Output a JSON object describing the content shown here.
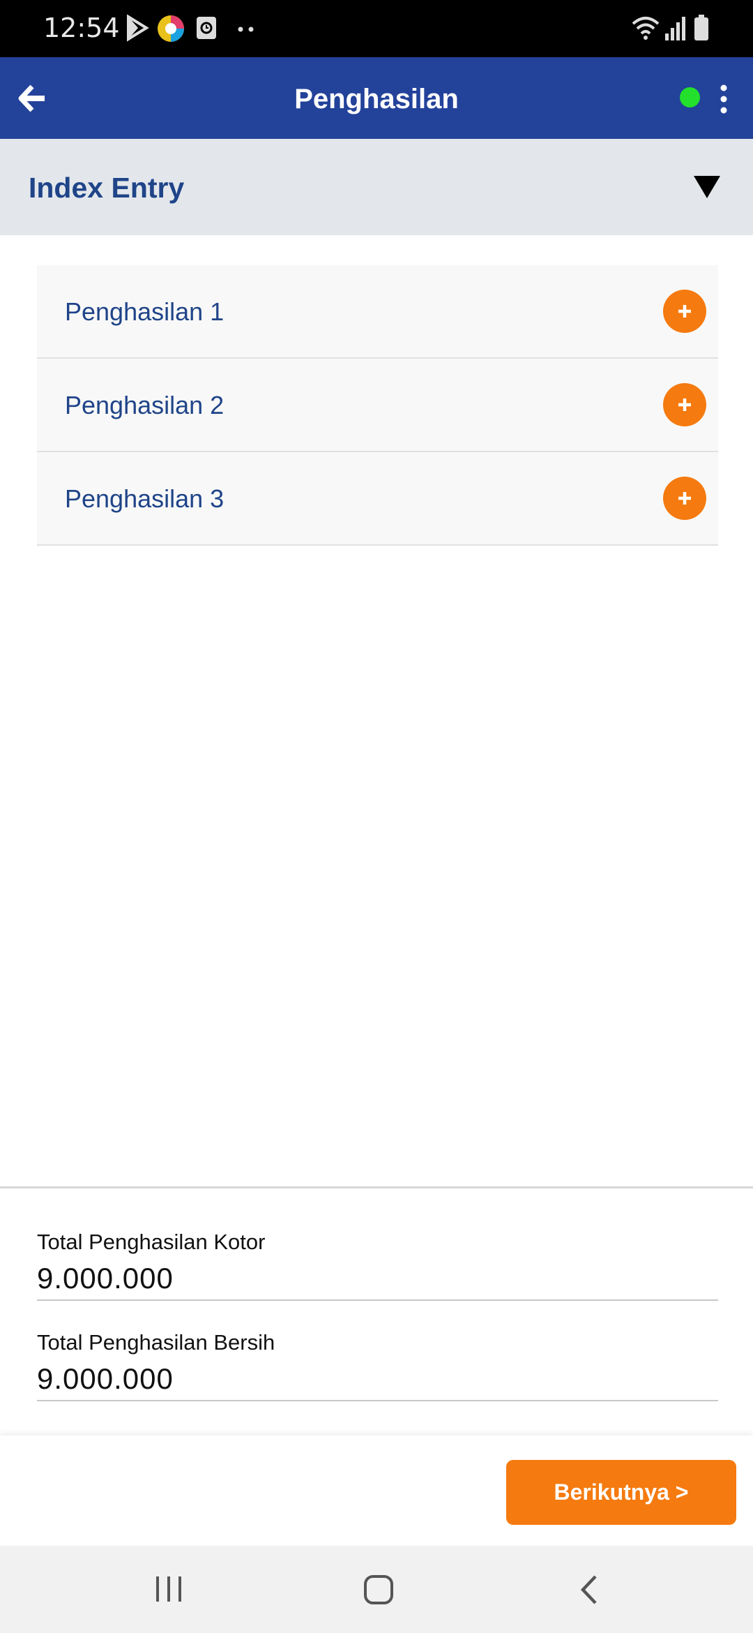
{
  "status_bar": {
    "time": "12:54",
    "icons": [
      "play-store-icon",
      "browser-icon",
      "screen-record-icon",
      "more-dots-icon",
      "wifi-icon",
      "signal-icon",
      "battery-icon"
    ]
  },
  "app_bar": {
    "title": "Penghasilan",
    "back_icon": "arrow-left-icon",
    "status_color": "#22e02c",
    "menu_icon": "more-vertical-icon"
  },
  "section": {
    "title": "Index Entry",
    "toggle_icon": "triangle-down-icon"
  },
  "income_items": [
    {
      "label": "Penghasilan 1",
      "action_icon": "plus-icon"
    },
    {
      "label": "Penghasilan 2",
      "action_icon": "plus-icon"
    },
    {
      "label": "Penghasilan 3",
      "action_icon": "plus-icon"
    }
  ],
  "totals": {
    "gross_label": "Total Penghasilan Kotor",
    "gross_value": "9.000.000",
    "net_label": "Total Penghasilan Bersih",
    "net_value": "9.000.000"
  },
  "actions": {
    "next_label": "Berikutnya >"
  },
  "nav_bar": {
    "icons": [
      "recent-apps-icon",
      "home-icon",
      "back-icon"
    ]
  },
  "colors": {
    "primary": "#23429a",
    "accent": "#f57a0f",
    "text_blue": "#1f4488"
  }
}
